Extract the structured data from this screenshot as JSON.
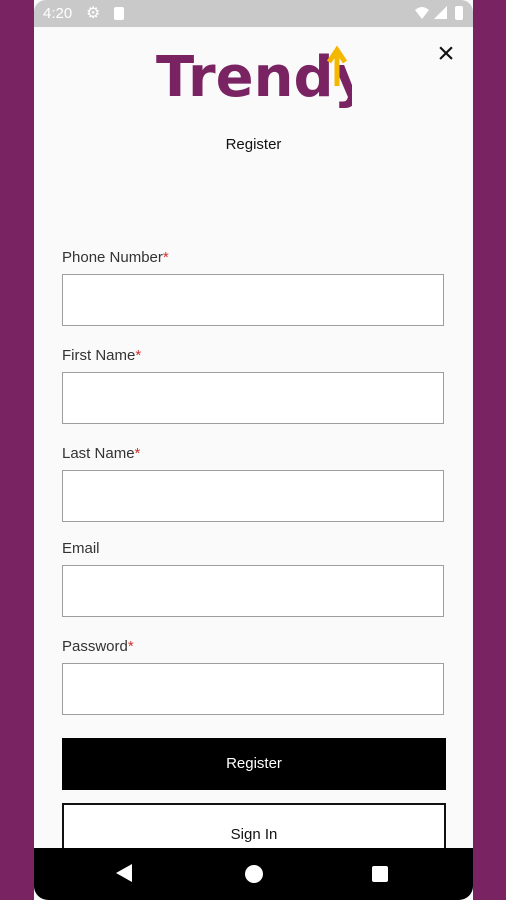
{
  "status_bar": {
    "time": "4:20"
  },
  "brand": {
    "name": "Trendy",
    "primary_color": "#7a2362",
    "accent_color": "#f5b800"
  },
  "page": {
    "title": "Register"
  },
  "fields": [
    {
      "label": "Phone Number",
      "required": "*",
      "value": ""
    },
    {
      "label": "First Name",
      "required": "*",
      "value": ""
    },
    {
      "label": "Last Name",
      "required": "*",
      "value": ""
    },
    {
      "label": "Email",
      "required": "",
      "value": ""
    },
    {
      "label": "Password",
      "required": "*",
      "value": ""
    }
  ],
  "buttons": {
    "register": "Register",
    "sign_in": "Sign In"
  },
  "icons": {
    "close": "close-icon",
    "back": "back-icon",
    "home": "home-icon",
    "recents": "recents-icon"
  }
}
